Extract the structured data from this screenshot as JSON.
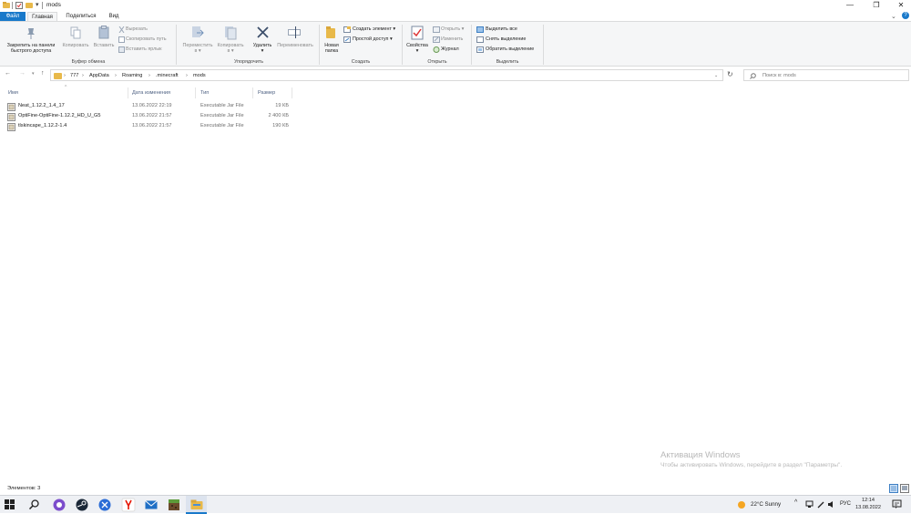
{
  "window": {
    "title": "mods",
    "minimize_glyph": "—",
    "maximize_glyph": "❐",
    "close_glyph": "✕"
  },
  "tabs": {
    "file": "Файл",
    "home": "Главная",
    "share": "Поделиться",
    "view": "Вид"
  },
  "ribbon": {
    "clipboard": {
      "pin": "Закрепить на панели быстрого доступа",
      "pin_line1": "Закрепить на панели",
      "pin_line2": "быстрого доступа",
      "copy": "Копировать",
      "paste": "Вставить",
      "cut": "Вырезать",
      "copy_path": "Скопировать путь",
      "paste_shortcut": "Вставить ярлык",
      "label": "Буфер обмена"
    },
    "organize": {
      "move_to_line1": "Переместить",
      "move_to_line2": "в ▾",
      "copy_to_line1": "Копировать",
      "copy_to_line2": "в ▾",
      "delete_line1": "Удалить",
      "delete_line2": "▾",
      "rename": "Переименовать",
      "label": "Упорядочить"
    },
    "new": {
      "new_folder_line1": "Новая",
      "new_folder_line2": "папка",
      "new_item": "Создать элемент ▾",
      "easy_access": "Простой доступ ▾",
      "label": "Создать"
    },
    "open": {
      "properties_line1": "Свойства",
      "properties_line2": "▾",
      "open": "Открыть ▾",
      "edit": "Изменить",
      "history": "Журнал",
      "label": "Открыть"
    },
    "select": {
      "select_all": "Выделить все",
      "select_none": "Снять выделение",
      "invert": "Обратить выделение",
      "label": "Выделить"
    }
  },
  "address": {
    "breadcrumbs": [
      "777",
      "AppData",
      "Roaming",
      ".minecraft",
      "mods"
    ],
    "search_placeholder": "Поиск в: mods"
  },
  "columns": {
    "name": "Имя",
    "date": "Дата изменения",
    "type": "Тип",
    "size": "Размер"
  },
  "files": [
    {
      "name": "Neat_1.12.2_1.4_17",
      "date": "13.06.2022 22:19",
      "type": "Executable Jar File",
      "size": "19 КБ"
    },
    {
      "name": "OptiFine-OptiFine-1.12.2_HD_U_G5",
      "date": "13.06.2022 21:57",
      "type": "Executable Jar File",
      "size": "2 400 КБ"
    },
    {
      "name": "tlskincape_1.12.2-1.4",
      "date": "13.06.2022 21:57",
      "type": "Executable Jar File",
      "size": "190 КБ"
    }
  ],
  "status": {
    "items": "Элементов: 3"
  },
  "watermark": {
    "line1": "Активация Windows",
    "line2": "Чтобы активировать Windows, перейдите в раздел \"Параметры\"."
  },
  "taskbar": {
    "weather": "22°C  Sunny",
    "lang": "РУС",
    "time": "12:14",
    "date": "13.08.2022"
  },
  "colors": {
    "accent": "#1979ca",
    "folder": "#e8b94a"
  },
  "icons": [
    "folder-icon",
    "pin-icon",
    "copy-icon",
    "paste-icon",
    "cut-icon",
    "move-icon",
    "delete-icon",
    "rename-icon",
    "new-folder-icon",
    "properties-icon",
    "jar-file-icon",
    "search-icon",
    "refresh-icon",
    "windows-start-icon",
    "steam-icon",
    "yandex-icon",
    "file-explorer-icon"
  ]
}
